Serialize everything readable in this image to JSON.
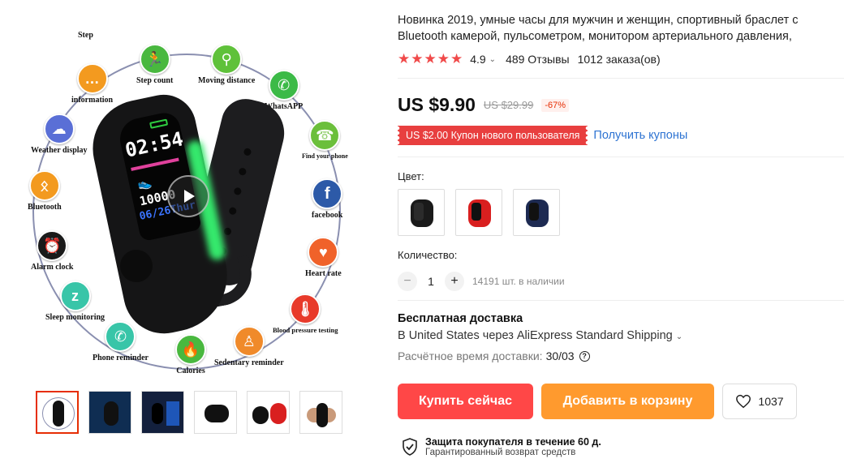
{
  "gallery": {
    "features": {
      "step": "Step",
      "step_count": "Step count",
      "moving_distance": "Moving distance",
      "information": "information",
      "whatsapp": "WhatsAPP",
      "weather": "Weather display",
      "find_phone": "Find your phone",
      "bluetooth": "Bluetooth",
      "facebook": "facebook",
      "alarm": "Alarm clock",
      "heart_rate": "Heart rate",
      "sleep": "Sleep monitoring",
      "blood_pressure": "Blood pressure testing",
      "phone_reminder": "Phone reminder",
      "sedentary": "Sedentary reminder",
      "calories": "Calories"
    },
    "screen": {
      "time": "02:54",
      "steps": "10000",
      "date": "06/26Thur"
    },
    "thumbnail_count": 6
  },
  "product": {
    "title": "Новинка 2019, умные часы для мужчин и женщин, спортивный браслет с Bluetooth камерой, пульсометром, монитором артериального давления, шагомером",
    "rating": {
      "stars": "★★★★★",
      "score": "4.9",
      "reviews": "489 Отзывы",
      "orders": "1012 заказа(ов)"
    },
    "price": {
      "current": "US $9.90",
      "old": "US $29.99",
      "discount": "-67%"
    },
    "coupon": {
      "badge": "US $2.00 Купон нового пользователя",
      "link": "Получить купоны"
    },
    "color": {
      "label": "Цвет:",
      "options": [
        {
          "strap": "#1a1a1a"
        },
        {
          "strap": "#d91f1f"
        },
        {
          "strap": "#1d2a52"
        }
      ]
    },
    "quantity": {
      "label": "Количество:",
      "value": "1",
      "stock": "14191 шт. в наличии"
    },
    "shipping": {
      "title": "Бесплатная доставка",
      "line": "В United States через AliExpress Standard Shipping",
      "eta_label": "Расчётное время доставки:",
      "eta_value": "30/03"
    },
    "actions": {
      "buy": "Купить сейчас",
      "cart": "Добавить в корзину",
      "wishlist_count": "1037"
    },
    "protection": {
      "title": "Защита покупателя в течение 60 д.",
      "subtitle": "Гарантированный возврат средств"
    }
  },
  "colors": {
    "primary_red": "#ff4747",
    "cart_orange": "#ff9a2e",
    "link_blue": "#2d73d2",
    "star_red": "#f04a4a"
  }
}
